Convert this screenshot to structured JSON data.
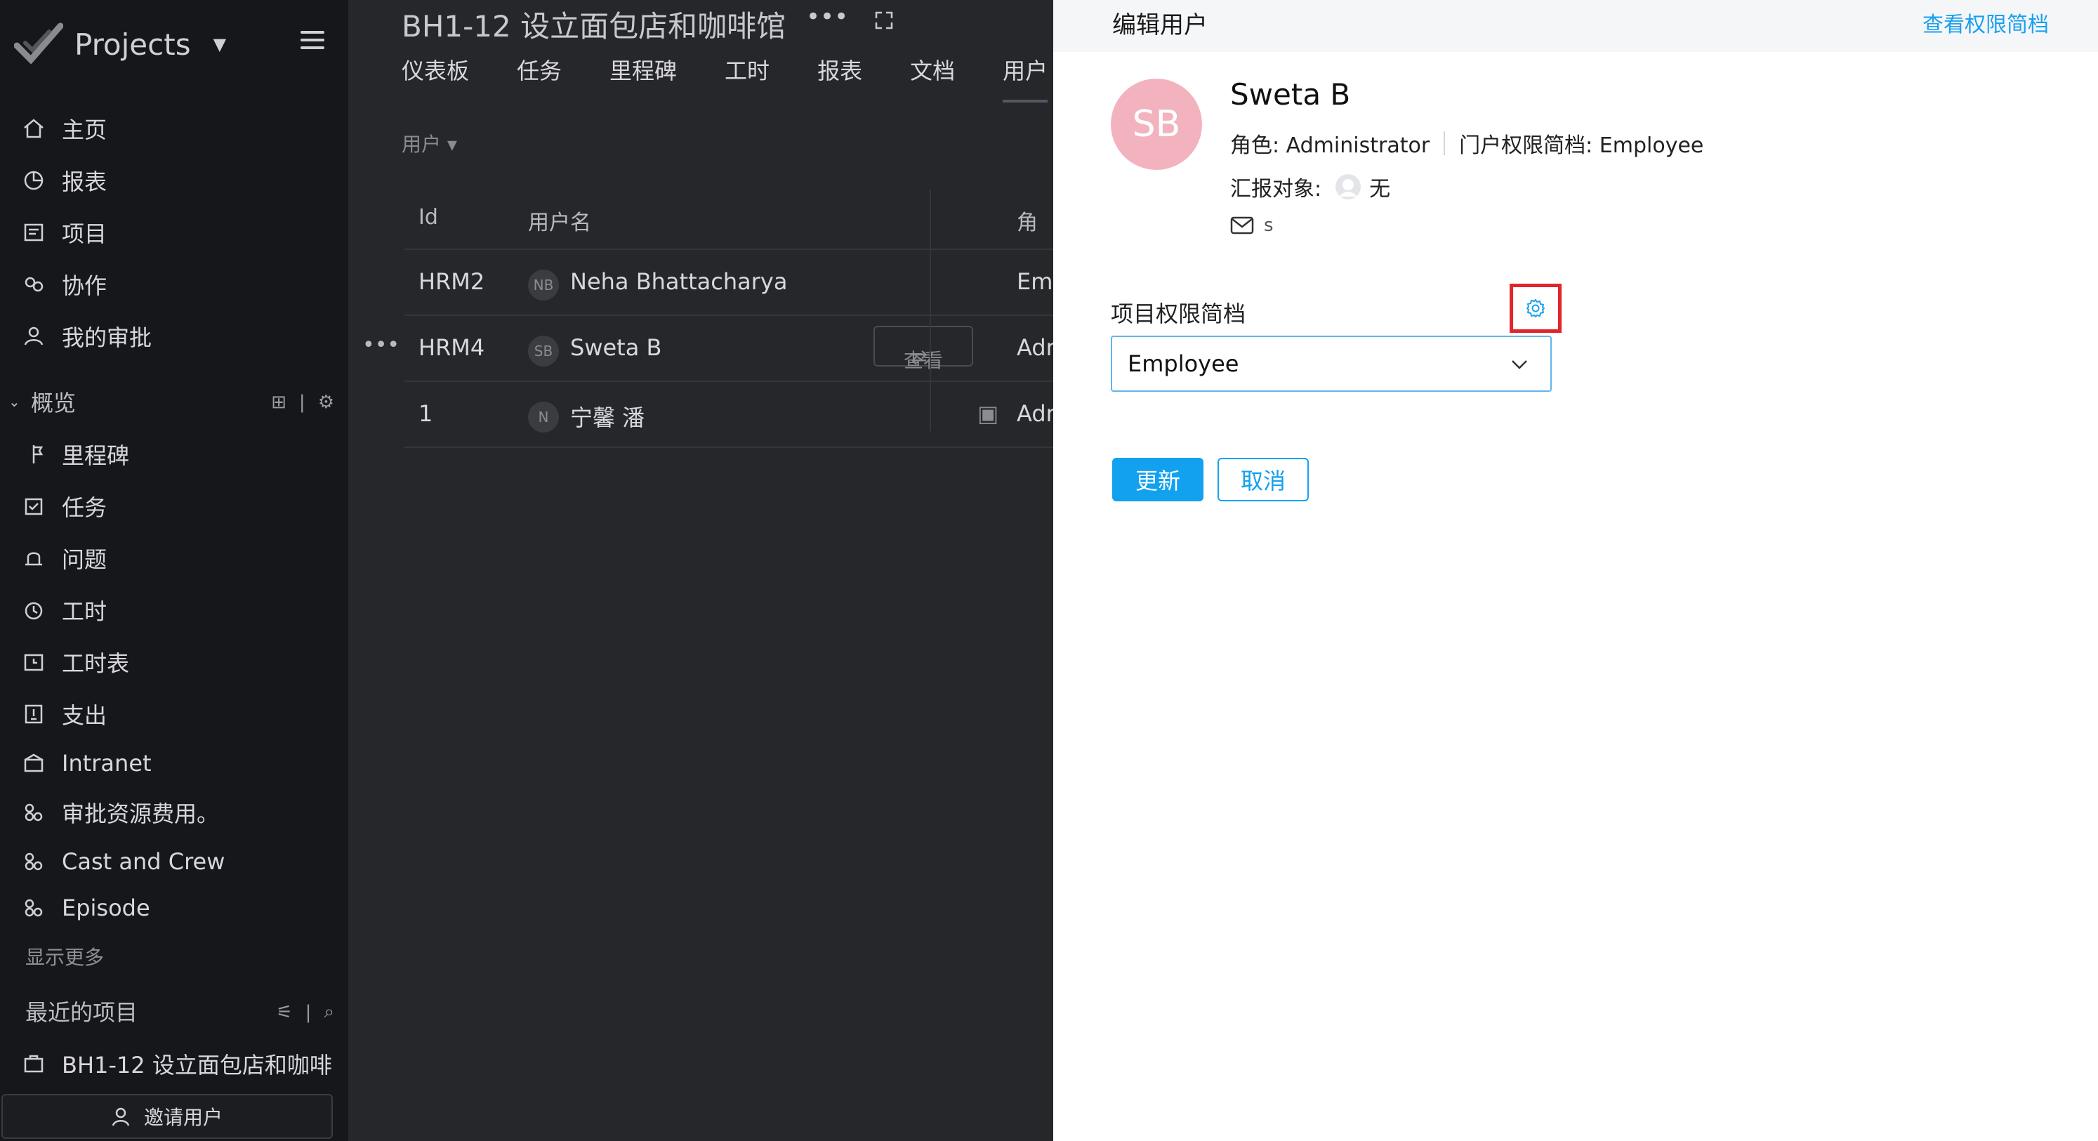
{
  "sidebar": {
    "brand": "Projects",
    "nav": [
      {
        "label": "主页",
        "icon": "home-icon"
      },
      {
        "label": "报表",
        "icon": "reports-icon"
      },
      {
        "label": "项目",
        "icon": "projects-icon"
      },
      {
        "label": "协作",
        "icon": "collaboration-icon"
      },
      {
        "label": "我的审批",
        "icon": "approval-icon"
      }
    ],
    "overview_label": "概览",
    "overview_items": [
      {
        "label": "里程碑",
        "icon": "milestone-icon"
      },
      {
        "label": "任务",
        "icon": "task-icon"
      },
      {
        "label": "问题",
        "icon": "bug-icon"
      },
      {
        "label": "工时",
        "icon": "timer-icon"
      },
      {
        "label": "工时表",
        "icon": "timesheet-icon"
      },
      {
        "label": "支出",
        "icon": "expense-icon"
      },
      {
        "label": "Intranet",
        "icon": "intranet-icon"
      },
      {
        "label": "审批资源费用。",
        "icon": "module-icon"
      },
      {
        "label": "Cast and Crew",
        "icon": "module-icon"
      },
      {
        "label": "Episode",
        "icon": "module-icon"
      }
    ],
    "show_more": "显示更多",
    "recent_label": "最近的项目",
    "recent_item": "BH1-12 设立面包店和咖啡",
    "invite": "邀请用户"
  },
  "project": {
    "title": "BH1-12 设立面包店和咖啡馆",
    "more": "•••",
    "tabs": [
      "仪表板",
      "任务",
      "里程碑",
      "工时",
      "报表",
      "文档",
      "用户"
    ],
    "filter": "用户 ▾",
    "columns": {
      "id": "Id",
      "name": "用户名",
      "role": "角"
    },
    "rows": [
      {
        "id": "HRM2",
        "initials": "NB",
        "name": "Neha Bhattacharya",
        "role": "Emp"
      },
      {
        "id": "HRM4",
        "initials": "SB",
        "name": "Sweta B",
        "role": "Adm",
        "view": "查看",
        "dots": "•••"
      },
      {
        "id": "1",
        "initials": "N",
        "name": "宁馨 潘",
        "role": "Adm"
      }
    ]
  },
  "panel": {
    "title": "编辑用户",
    "view_profiles_link": "查看权限简档",
    "avatar_initials": "SB",
    "user_name": "Sweta B",
    "role_text": "角色: Administrator",
    "portal_profile_text": "门户权限简档: Employee",
    "reports_to_label": "汇报对象:",
    "reports_to_value": "无",
    "email_value": "s",
    "project_profile_label": "项目权限简档",
    "project_profile_value": "Employee",
    "update_button": "更新",
    "cancel_button": "取消"
  },
  "colors": {
    "accent": "#12a1ef",
    "highlight_box": "#e0252b",
    "avatar_bg": "#f2b3bf"
  }
}
